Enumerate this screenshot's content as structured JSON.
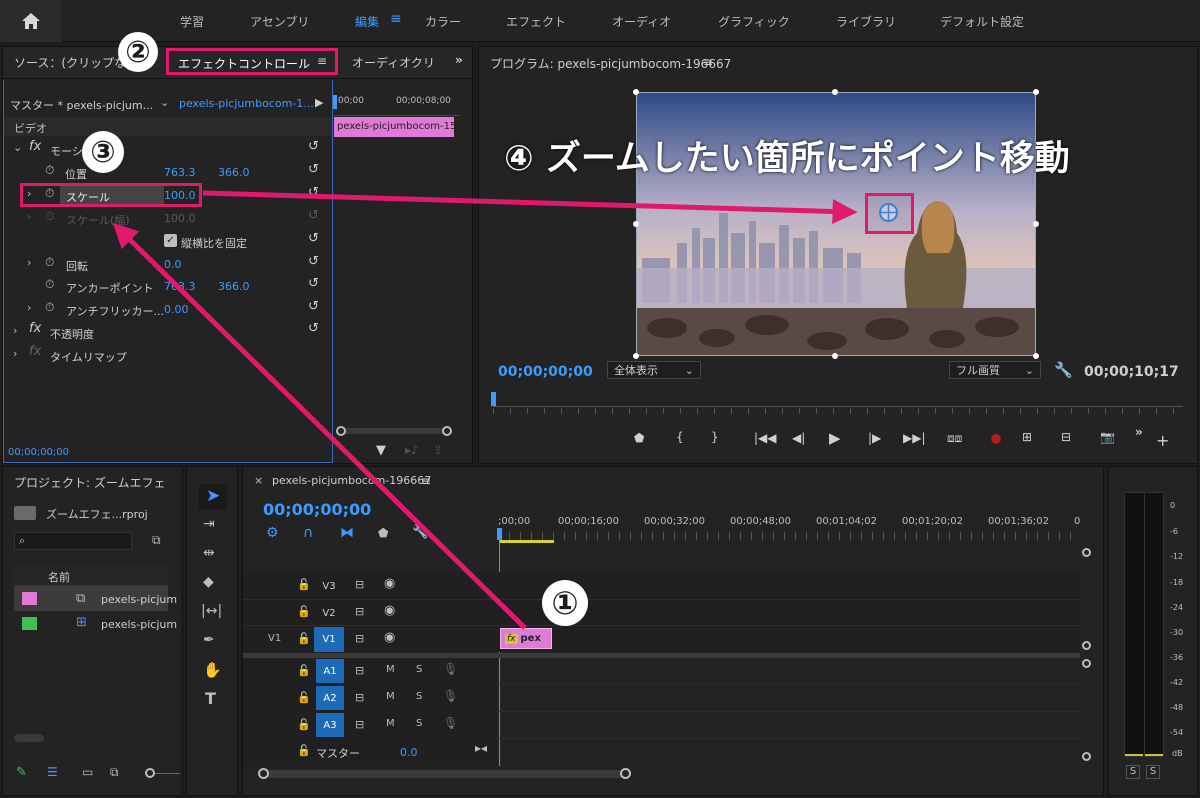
{
  "workspace_tabs": [
    "学習",
    "アセンブリ",
    "編集",
    "カラー",
    "エフェクト",
    "オーディオ",
    "グラフィック",
    "ライブラリ",
    "デフォルト設定"
  ],
  "active_tab": "編集",
  "source_panel": {
    "tab_source": "ソース：(クリップな",
    "tab_effect_controls": "エフェクトコントロール",
    "tab_audio": "オーディオクリ",
    "master_label": "マスター * pexels-picjum...",
    "clip_label": "pexels-picjumbocom-1...",
    "ruler_start": ";00;00",
    "ruler_end": "00;00;08;00",
    "mini_clip": "pexels-picjumbocom-15",
    "section_video": "ビデオ",
    "motion": "モーション",
    "position_label": "位置",
    "position_x": "763.3",
    "position_y": "366.0",
    "scale_label": "スケール",
    "scale_value": "100.0",
    "scale_width_label": "スケール(幅)",
    "scale_width_value": "100.0",
    "uniform_scale": "縦横比を固定",
    "rotation_label": "回転",
    "rotation_value": "0.0",
    "anchor_label": "アンカーポイント",
    "anchor_x": "763.3",
    "anchor_y": "366.0",
    "antiflicker_label": "アンチフリッカー...",
    "antiflicker_value": "0.00",
    "opacity_label": "不透明度",
    "timeremap_label": "タイムリマップ",
    "timecode": "00;00;00;00"
  },
  "program_panel": {
    "title": "プログラム: pexels-picjumbocom-196667",
    "timecode_current": "00;00;00;00",
    "zoom_select": "全体表示",
    "quality_select": "フル画質",
    "timecode_duration": "00;00;10;17"
  },
  "project_panel": {
    "title": "プロジェクト: ズームエフェ",
    "project_file": "ズームエフェ...rproj",
    "search_placeholder": "",
    "column_name": "名前",
    "items": [
      "pexels-picjum",
      "pexels-picjum"
    ]
  },
  "timeline": {
    "sequence_name": "pexels-picjumbocom-196667",
    "timecode": "00;00;00;00",
    "ruler": [
      ";00;00",
      "00;00;16;00",
      "00;00;32;00",
      "00;00;48;00",
      "00;01;04;02",
      "00;01;20;02",
      "00;01;36;02",
      "0"
    ],
    "video_tracks": [
      "V3",
      "V2",
      "V1"
    ],
    "audio_tracks": [
      "A1",
      "A2",
      "A3"
    ],
    "source_v1": "V1",
    "master_label": "マスター",
    "master_value": "0.0",
    "clip_label": "pex",
    "m_label": "M",
    "s_label": "S"
  },
  "meter": {
    "scale": [
      "0",
      "-6",
      "-12",
      "-18",
      "-24",
      "-30",
      "-36",
      "-42",
      "-48",
      "-54",
      "dB"
    ],
    "solo": [
      "S",
      "S"
    ]
  },
  "annotations": {
    "step1": "①",
    "step2": "②",
    "step3": "③",
    "step4": "④ ズームしたい箇所にポイント移動"
  },
  "colors": {
    "accent": "#3d9bff",
    "annotation": "#e0196b",
    "clip": "#e07ad6",
    "track_on": "#1d6ab7"
  }
}
